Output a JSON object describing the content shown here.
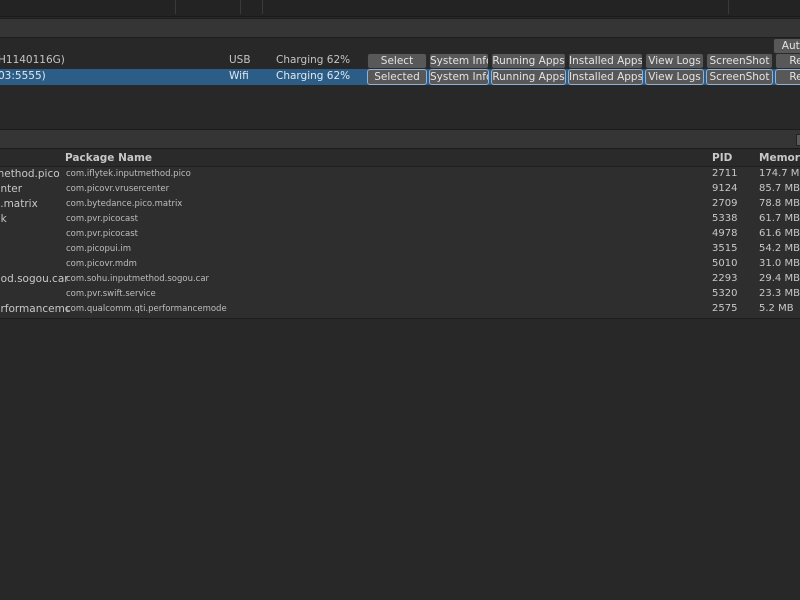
{
  "toolbar": {
    "auto_button": "Auto"
  },
  "devices": [
    {
      "id_text": "H1140116G)",
      "connection": "USB",
      "battery": "Charging 62%",
      "buttons": [
        "Select",
        "System Info",
        "Running Apps",
        "Installed Apps",
        "View Logs",
        "ScreenShot",
        "Re"
      ],
      "selected": false
    },
    {
      "id_text": "03:5555)",
      "connection": "Wifi",
      "battery": "Charging 62%",
      "buttons": [
        "Selected",
        "System Info",
        "Running Apps",
        "Installed Apps",
        "View Logs",
        "ScreenShot",
        "Re"
      ],
      "selected": true
    }
  ],
  "processes": {
    "columns": {
      "name": "",
      "package": "Package Name",
      "pid": "PID",
      "memory": "Memory U"
    },
    "rows": [
      {
        "name": "method.pico",
        "package": "com.iflytek.inputmethod.pico",
        "pid": "2711",
        "memory": "174.7 MB"
      },
      {
        "name": "enter",
        "package": "com.picovr.vrusercenter",
        "pid": "9124",
        "memory": "85.7 MB"
      },
      {
        "name": "o.matrix",
        "package": "com.bytedance.pico.matrix",
        "pid": "2709",
        "memory": "78.8 MB"
      },
      {
        "name": "nk",
        "package": "com.pvr.picocast",
        "pid": "5338",
        "memory": "61.7 MB"
      },
      {
        "name": "",
        "package": "com.pvr.picocast",
        "pid": "4978",
        "memory": "61.6 MB"
      },
      {
        "name": "",
        "package": "com.picopui.im",
        "pid": "3515",
        "memory": "54.2 MB"
      },
      {
        "name": "",
        "package": "com.picovr.mdm",
        "pid": "5010",
        "memory": "31.0 MB"
      },
      {
        "name": "hod.sogou.car",
        "package": "com.sohu.inputmethod.sogou.car",
        "pid": "2293",
        "memory": "29.4 MB"
      },
      {
        "name": "e",
        "package": "com.pvr.swift.service",
        "pid": "5320",
        "memory": "23.3 MB"
      },
      {
        "name": "erformancemc",
        "package": "com.qualcomm.qti.performancemode",
        "pid": "2575",
        "memory": "5.2 MB"
      }
    ]
  }
}
